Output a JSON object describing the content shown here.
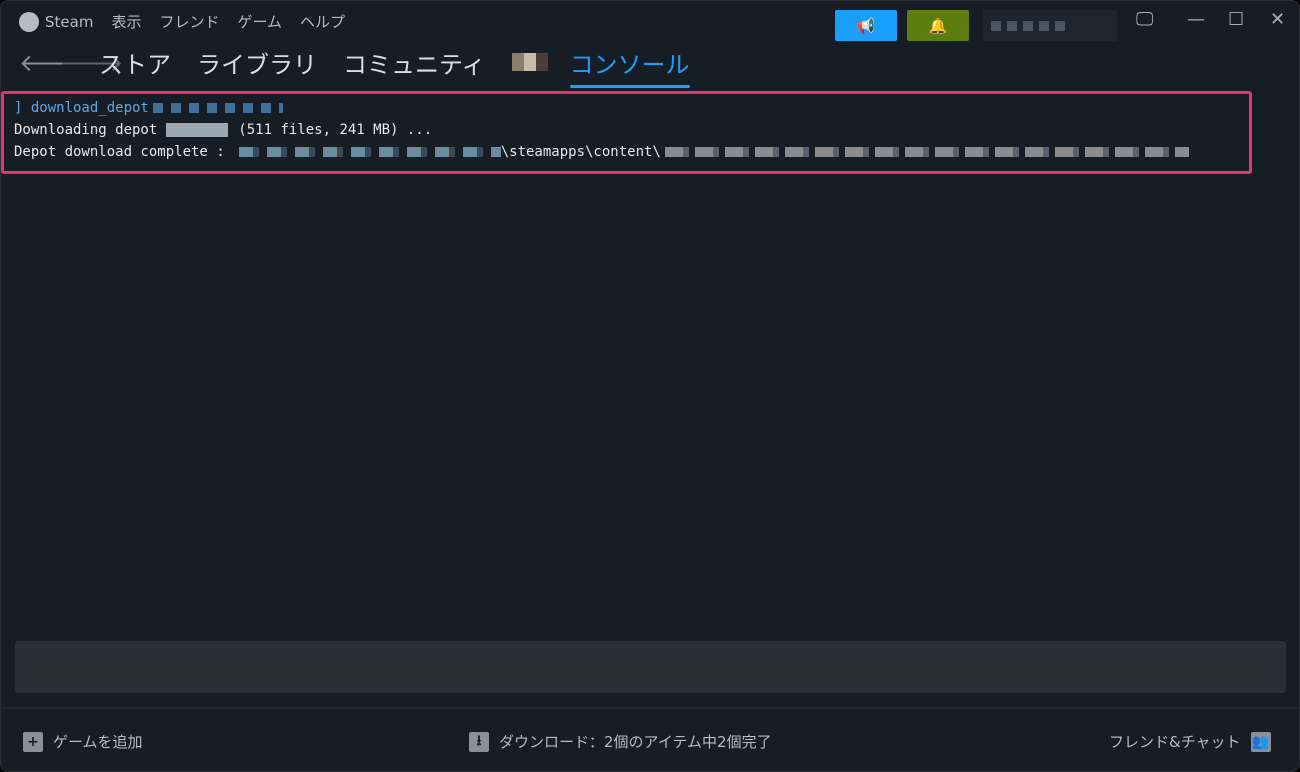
{
  "menu": {
    "app": "Steam",
    "items": [
      "表示",
      "フレンド",
      "ゲーム",
      "ヘルプ"
    ]
  },
  "nav": {
    "tabs": [
      "ストア",
      "ライブラリ",
      "コミュニティ"
    ],
    "active_tab": "コンソール"
  },
  "console": {
    "command": "] download_depot",
    "line2_prefix": "Downloading depot",
    "line2_suffix": "(511 files, 241 MB) ...",
    "line3_prefix": "Depot download complete :",
    "line3_path": "\\steamapps\\content\\"
  },
  "footer": {
    "add_game": "ゲームを追加",
    "downloads": "ダウンロード：2個のアイテム中2個完了",
    "friends": "フレンド&チャット"
  },
  "colors": {
    "accent": "#1a9fff",
    "notif": "#5c7e10",
    "highlight": "#e8336a"
  }
}
